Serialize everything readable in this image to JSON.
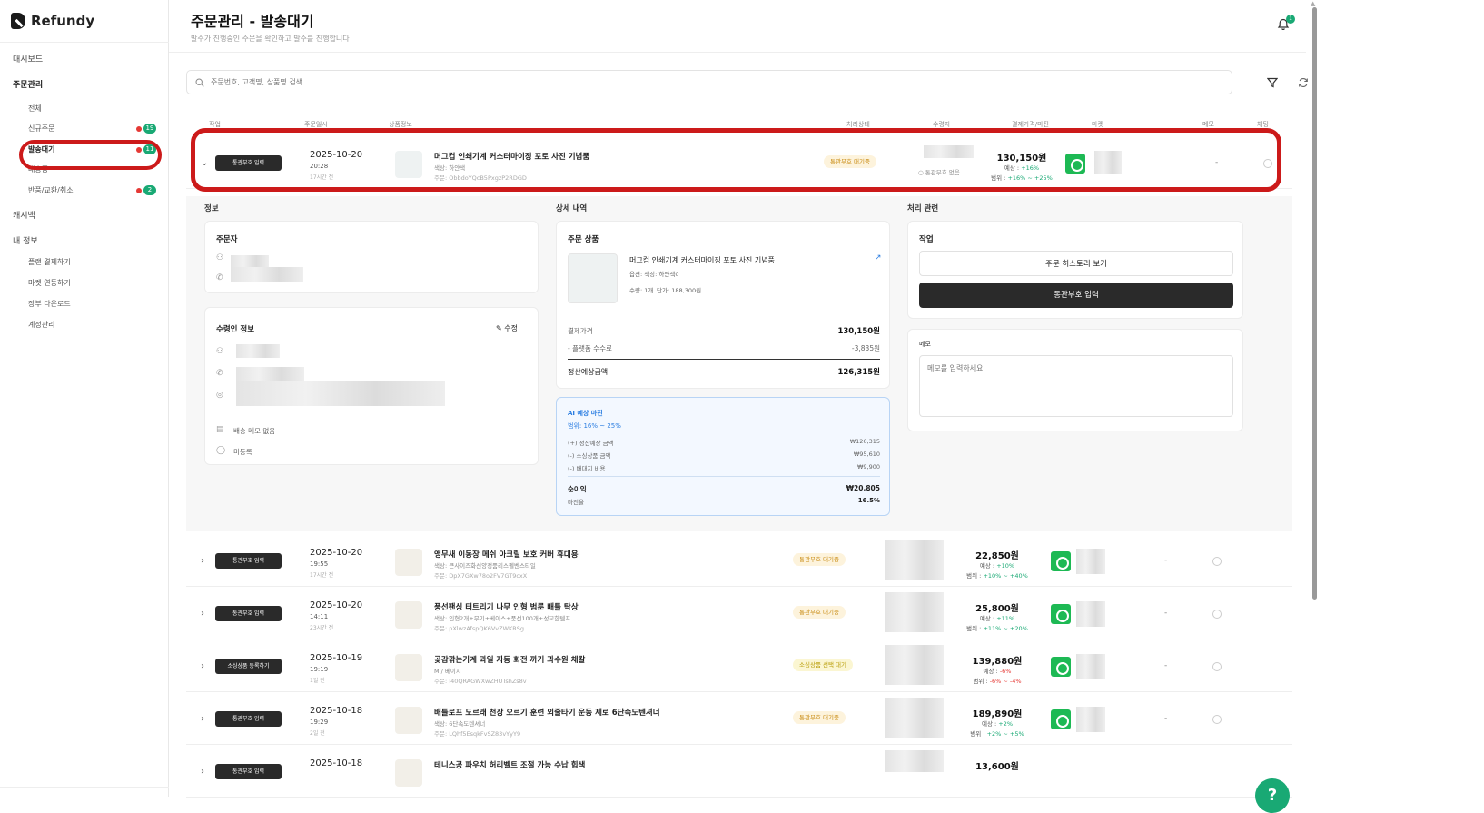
{
  "app": {
    "logo_text": "Refundy"
  },
  "sidebar": {
    "dashboard": "대시보드",
    "orders": "주문관리",
    "order_items": [
      {
        "label": "전체"
      },
      {
        "label": "신규주문",
        "count": "19"
      },
      {
        "label": "발송대기",
        "count": "11"
      },
      {
        "label": "배송중"
      },
      {
        "label": "반품/교환/취소",
        "count": "2"
      }
    ],
    "cashback": "캐시백",
    "my_info": "내 정보",
    "info_items": [
      {
        "label": "플랜 결제하기"
      },
      {
        "label": "마켓 연동하기"
      },
      {
        "label": "장부 다운로드"
      },
      {
        "label": "계정관리"
      }
    ]
  },
  "header": {
    "title": "주문관리 - 발송대기",
    "subtitle": "발주가 진행중인 주문을 확인하고 발주를 진행합니다",
    "notification_count": "1"
  },
  "search": {
    "placeholder": "주문번호, 고객명, 상품명 검색"
  },
  "table": {
    "headers": [
      "작업",
      "주문일시",
      "상품정보",
      "처리상태",
      "수령자",
      "결제가격/마진",
      "마켓",
      "메모",
      "채팅"
    ]
  },
  "first_row": {
    "action": "통관부호 입력",
    "date": "2025-10-20",
    "time": "20:28",
    "ago": "17시간 전",
    "name": "머그컵 인쇄기계 커스터마이징 포토 사진 기념품",
    "option": "색상: 하얀색",
    "code": "주문: ObbdoYQcB5PxgzP2RDGD",
    "status": "통관부호 대기중",
    "recipient_note": "통관부호 없음",
    "price": "130,150원",
    "expected_prefix": "예상 : ",
    "expected": "+16%",
    "range_prefix": "범위 : ",
    "range": "+16% ~ +25%",
    "memo": "-"
  },
  "detail": {
    "info_title": "정보",
    "orderer_title": "주문자",
    "recipient_title": "수령인 정보",
    "edit_label": "수정",
    "delivery_memo": "배송 메모 없음",
    "unregistered": "미등록",
    "detail_title": "상세 내역",
    "product_title": "주문 상품",
    "product_name": "머그컵 인쇄기계 커스터마이징 포토 사진 기념품",
    "product_option": "옵션: 색상: 하얀색0",
    "product_qty": "수량: 1개",
    "product_unit": "단가: 188,300원",
    "pay_label": "결제가격",
    "pay_value": "130,150원",
    "fee_label": "- 플랫폼 수수료",
    "fee_value": "-3,835원",
    "settle_label": "정산예상금액",
    "settle_value": "126,315원",
    "ai_title": "AI 예상 마진",
    "ai_range": "범위: 16% ~ 25%",
    "ai_items": [
      {
        "label": "(+) 정산예상 금액",
        "value": "₩126,315"
      },
      {
        "label": "(-) 소싱상품 금액",
        "value": "₩95,610"
      },
      {
        "label": "(-) 배대지 비용",
        "value": "₩9,900"
      }
    ],
    "profit_label": "순이익",
    "profit_value": "₩20,805",
    "margin_label": "마진율",
    "margin_value": "16.5%",
    "process_title": "처리 관련",
    "task_title": "작업",
    "history_button": "주문 히스토리 보기",
    "customs_button": "통관부호 입력",
    "memo_title": "메모",
    "memo_placeholder": "메모를 입력하세요"
  },
  "rows": [
    {
      "action": "통관부호 입력",
      "date": "2025-10-20",
      "time": "19:55",
      "ago": "17시간 전",
      "name": "앵무새 이동장 메쉬 아크릴 보호 커버 휴대용",
      "option": "색상: 큰사이즈화선양정품리스펠벤스티일",
      "code": "주문: DpX7GXw78o2FV7GT9cxX",
      "status": "통관부호 대기중",
      "price": "22,850원",
      "expected": "+10%",
      "range": "+10% ~ +40%",
      "memo": "-"
    },
    {
      "action": "통관부호 입력",
      "date": "2025-10-20",
      "time": "14:11",
      "ago": "23시간 전",
      "name": "풍선팬싱 터트리기 나무 인형 범룬 배틀 탁상",
      "option": "색상: 인형2개+무기+베이스+풍선100개+성교한템프",
      "code": "주문: pXlwzAfspQK6VvZWKRSg",
      "status": "통관부호 대기중",
      "price": "25,800원",
      "expected": "+11%",
      "range": "+11% ~ +20%",
      "memo": "-"
    },
    {
      "action": "소싱상품 등록하기",
      "date": "2025-10-19",
      "time": "19:19",
      "ago": "1일 전",
      "name": "곶감깎는기계 과일 자동 회전 까기 과수원 채칼",
      "option": "M / 베이지",
      "code": "주문: I40QRAGWXwZHUTshZs8v",
      "status": "소싱상품 선택 대기",
      "price": "139,880원",
      "expected": "-6%",
      "range": "-6% ~ -4%",
      "memo": "-"
    },
    {
      "action": "통관부호 입력",
      "date": "2025-10-18",
      "time": "19:29",
      "ago": "2일 전",
      "name": "배틀로프 도르래 천장 오르기 훈련 외줄타기 운동 제로 6단속도텐셔너",
      "option": "색상: 6단속도텐셔너",
      "code": "주문: LQhf5EsqkFvSZ83vYyY9",
      "status": "통관부호 대기중",
      "price": "189,890원",
      "expected": "+2%",
      "range": "+2% ~ +5%",
      "memo": "-"
    },
    {
      "action": "통관부호 입력",
      "date": "2025-10-18",
      "time": "",
      "ago": "",
      "name": "테니스공 파우치 허리벨트 조절 가능 수납 힙색",
      "option": "",
      "code": "",
      "status": "",
      "price": "13,600원",
      "expected": "",
      "range": "",
      "memo": ""
    }
  ],
  "labels": {
    "expected_prefix": "예상 : ",
    "range_prefix": "범위 : "
  },
  "help": {
    "label": "?"
  },
  "colors": {
    "accent": "#19a974",
    "highlight": "#cc1a1a",
    "dark_button": "#2a2a2a",
    "status_bg": "#fdf3dc",
    "status_text": "#c88a10"
  }
}
